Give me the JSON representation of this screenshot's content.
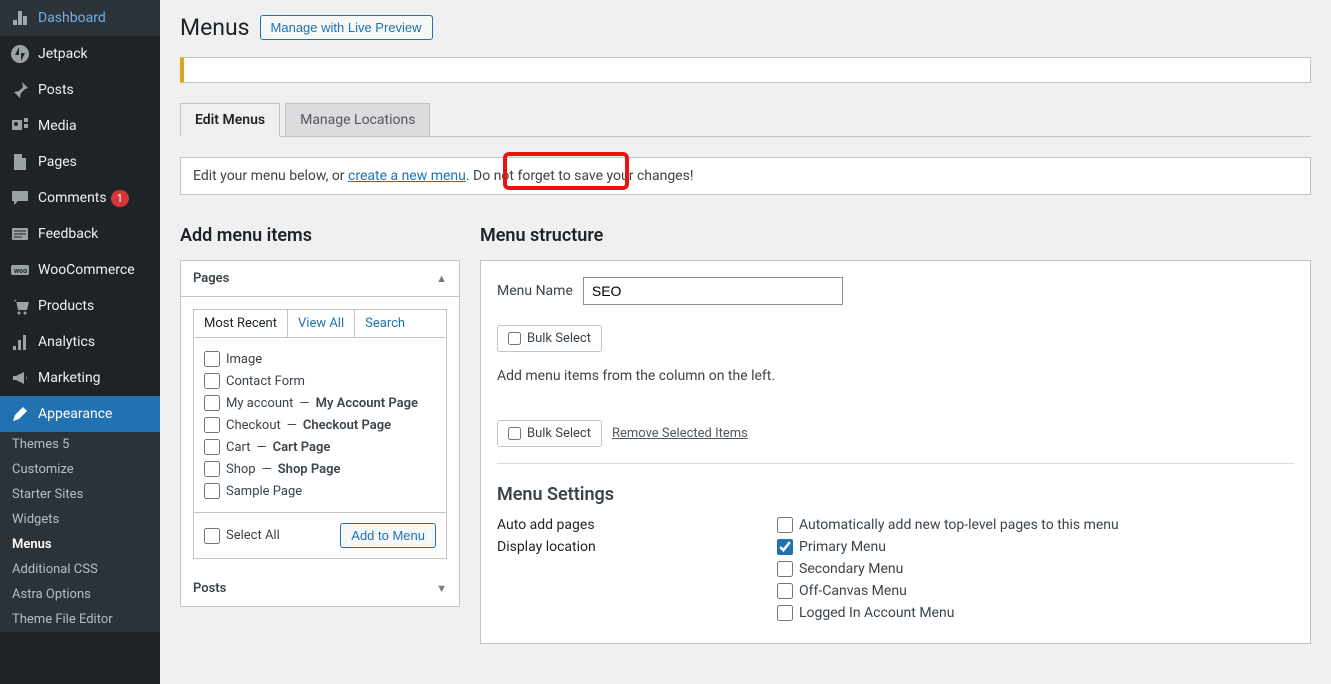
{
  "sidebar": {
    "items": [
      {
        "label": "Dashboard",
        "icon": "dashboard"
      },
      {
        "label": "Jetpack",
        "icon": "jetpack"
      },
      {
        "label": "Posts",
        "icon": "pin"
      },
      {
        "label": "Media",
        "icon": "media"
      },
      {
        "label": "Pages",
        "icon": "pages"
      },
      {
        "label": "Comments",
        "icon": "comments",
        "badge": "1"
      },
      {
        "label": "Feedback",
        "icon": "feedback"
      },
      {
        "label": "WooCommerce",
        "icon": "woo"
      },
      {
        "label": "Products",
        "icon": "products"
      },
      {
        "label": "Analytics",
        "icon": "analytics"
      },
      {
        "label": "Marketing",
        "icon": "marketing"
      },
      {
        "label": "Appearance",
        "icon": "appearance",
        "active": true
      }
    ],
    "submenu": [
      {
        "label": "Themes",
        "badge": "5"
      },
      {
        "label": "Customize"
      },
      {
        "label": "Starter Sites"
      },
      {
        "label": "Widgets"
      },
      {
        "label": "Menus",
        "current": true
      },
      {
        "label": "Additional CSS"
      },
      {
        "label": "Astra Options"
      },
      {
        "label": "Theme File Editor"
      }
    ]
  },
  "page": {
    "title": "Menus",
    "preview_button": "Manage with Live Preview"
  },
  "tabs": {
    "edit": "Edit Menus",
    "locations": "Manage Locations"
  },
  "info": {
    "prefix": "Edit your menu below, or ",
    "link": "create a new menu",
    "suffix": ". Do not forget to save your changes!"
  },
  "left": {
    "title": "Add menu items",
    "accordion_pages": "Pages",
    "accordion_posts": "Posts",
    "inner_tabs": {
      "recent": "Most Recent",
      "all": "View All",
      "search": "Search"
    },
    "pages": [
      {
        "label": "Image"
      },
      {
        "label": "Contact Form"
      },
      {
        "label": "My account",
        "suffix": "My Account Page"
      },
      {
        "label": "Checkout",
        "suffix": "Checkout Page"
      },
      {
        "label": "Cart",
        "suffix": "Cart Page"
      },
      {
        "label": "Shop",
        "suffix": "Shop Page"
      },
      {
        "label": "Sample Page"
      }
    ],
    "select_all": "Select All",
    "add_to_menu": "Add to Menu"
  },
  "right": {
    "title": "Menu structure",
    "menu_name_label": "Menu Name",
    "menu_name_value": "SEO",
    "bulk_select": "Bulk Select",
    "help_text": "Add menu items from the column on the left.",
    "remove_selected": "Remove Selected Items",
    "settings_title": "Menu Settings",
    "auto_add_label": "Auto add pages",
    "auto_add_opt": "Automatically add new top-level pages to this menu",
    "display_location_label": "Display location",
    "locations": [
      {
        "label": "Primary Menu",
        "checked": true
      },
      {
        "label": "Secondary Menu",
        "checked": false
      },
      {
        "label": "Off-Canvas Menu",
        "checked": false
      },
      {
        "label": "Logged In Account Menu",
        "checked": false
      }
    ]
  }
}
